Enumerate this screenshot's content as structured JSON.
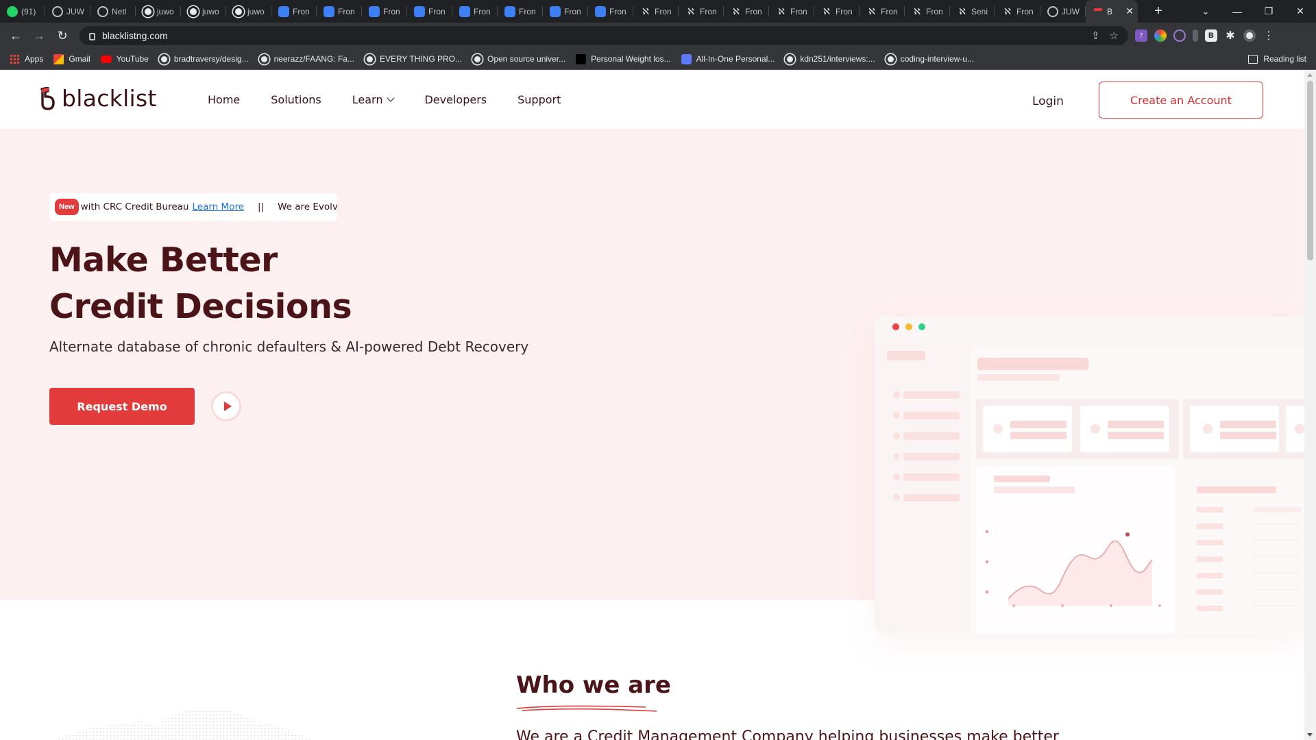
{
  "browser": {
    "tabs": [
      {
        "label": "(91)",
        "icon": "whatsapp-icon"
      },
      {
        "label": "JUW",
        "icon": "globe-icon"
      },
      {
        "label": "Netl",
        "icon": "globe-icon"
      },
      {
        "label": "juwo",
        "icon": "github-icon"
      },
      {
        "label": "juwo",
        "icon": "github-icon"
      },
      {
        "label": "juwo",
        "icon": "github-icon"
      },
      {
        "label": "Fron",
        "icon": "netlify-icon"
      },
      {
        "label": "Fron",
        "icon": "netlify-icon"
      },
      {
        "label": "Fron",
        "icon": "netlify-icon"
      },
      {
        "label": "Fron",
        "icon": "netlify-icon"
      },
      {
        "label": "Fron",
        "icon": "netlify-icon"
      },
      {
        "label": "Fron",
        "icon": "netlify-icon"
      },
      {
        "label": "Fron",
        "icon": "netlify-icon"
      },
      {
        "label": "Fron",
        "icon": "netlify-icon"
      },
      {
        "label": "Fron",
        "icon": "glitch-icon"
      },
      {
        "label": "Fron",
        "icon": "glitch-icon"
      },
      {
        "label": "Fron",
        "icon": "glitch-icon"
      },
      {
        "label": "Fron",
        "icon": "glitch-icon"
      },
      {
        "label": "Fron",
        "icon": "glitch-icon"
      },
      {
        "label": "Fron",
        "icon": "glitch-icon"
      },
      {
        "label": "Fron",
        "icon": "glitch-icon"
      },
      {
        "label": "Seni",
        "icon": "glitch-icon"
      },
      {
        "label": "Fron",
        "icon": "glitch-icon"
      },
      {
        "label": "JUW",
        "icon": "globe-icon"
      }
    ],
    "active_tab": {
      "label": "B",
      "icon": "blacklist-icon"
    },
    "url": "blacklistng.com",
    "bookmarks": [
      {
        "label": "Apps",
        "icon": "apps-icon"
      },
      {
        "label": "Gmail",
        "icon": "gmail-icon"
      },
      {
        "label": "YouTube",
        "icon": "youtube-icon"
      },
      {
        "label": "bradtraversy/desig...",
        "icon": "github-icon"
      },
      {
        "label": "neerazz/FAANG: Fa...",
        "icon": "github-icon"
      },
      {
        "label": "EVERY THING PRO...",
        "icon": "github-icon"
      },
      {
        "label": "Open source univer...",
        "icon": "github-icon"
      },
      {
        "label": "Personal Weight los...",
        "icon": "dark-site-icon"
      },
      {
        "label": "All-In-One Personal...",
        "icon": "app-icon"
      },
      {
        "label": "kdn251/interviews:...",
        "icon": "github-icon"
      },
      {
        "label": "coding-interview-u...",
        "icon": "github-icon"
      }
    ],
    "reading_list": "Reading list",
    "extension_badge": "7"
  },
  "site": {
    "logo_text": "blacklist",
    "nav": [
      "Home",
      "Solutions",
      "Learn",
      "Developers",
      "Support"
    ],
    "login": "Login",
    "cta": "Create an Account",
    "ticker": {
      "badge": "New",
      "text": "with CRC Credit Bureau",
      "link": "Learn More",
      "separator": "||",
      "next": "We are Evolvin"
    },
    "hero_title_line1": "Make Better",
    "hero_title_line2": "Credit Decisions",
    "hero_subtitle": "Alternate database of chronic defaulters & AI-powered Debt Recovery",
    "demo_button": "Request Demo",
    "who_title": "Who we are",
    "who_text": "We are a Credit Management Company helping businesses make better"
  },
  "colors": {
    "brand_red": "#e23b3b",
    "brand_dark": "#4a1418",
    "hero_bg": "#fdf0f0",
    "mock_dot_red": "#ee4444",
    "mock_dot_yellow": "#f5b82e",
    "mock_dot_green": "#2fd18a"
  }
}
